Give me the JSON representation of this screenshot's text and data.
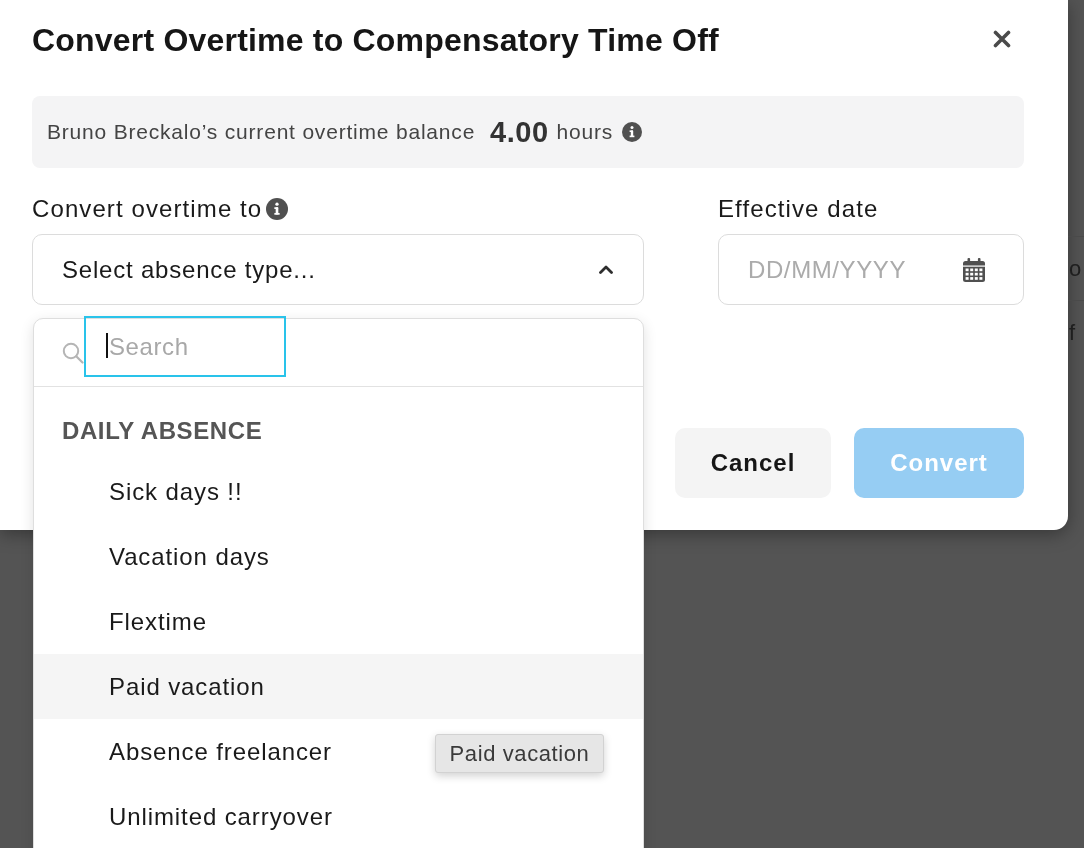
{
  "dialog": {
    "title": "Convert Overtime to Compensatory Time Off"
  },
  "balance": {
    "label": "Bruno Breckalo’s current overtime balance",
    "value": "4.00",
    "unit": "hours"
  },
  "convert_field": {
    "label": "Convert overtime to",
    "placeholder": "Select absence type...",
    "expanded": true
  },
  "date_field": {
    "label": "Effective date",
    "placeholder": "DD/MM/YYYY"
  },
  "buttons": [
    {
      "label": "Cancel",
      "kind": "secondary",
      "disabled": false
    },
    {
      "label": "Convert",
      "kind": "primary",
      "disabled": true
    }
  ],
  "dropdown": {
    "search": {
      "placeholder": "Search",
      "focused": true
    },
    "groups": [
      {
        "heading": "DAILY ABSENCE",
        "items": [
          {
            "label": "Sick days !!",
            "highlighted": false
          },
          {
            "label": "Vacation days",
            "highlighted": false
          },
          {
            "label": "Flextime",
            "highlighted": false
          },
          {
            "label": "Paid vacation",
            "highlighted": true
          },
          {
            "label": "Absence freelancer",
            "highlighted": false
          },
          {
            "label": "Unlimited carryover",
            "highlighted": false
          }
        ]
      }
    ],
    "tooltip": "Paid vacation"
  },
  "background_page": {
    "fragments": [
      "o",
      "f"
    ]
  }
}
